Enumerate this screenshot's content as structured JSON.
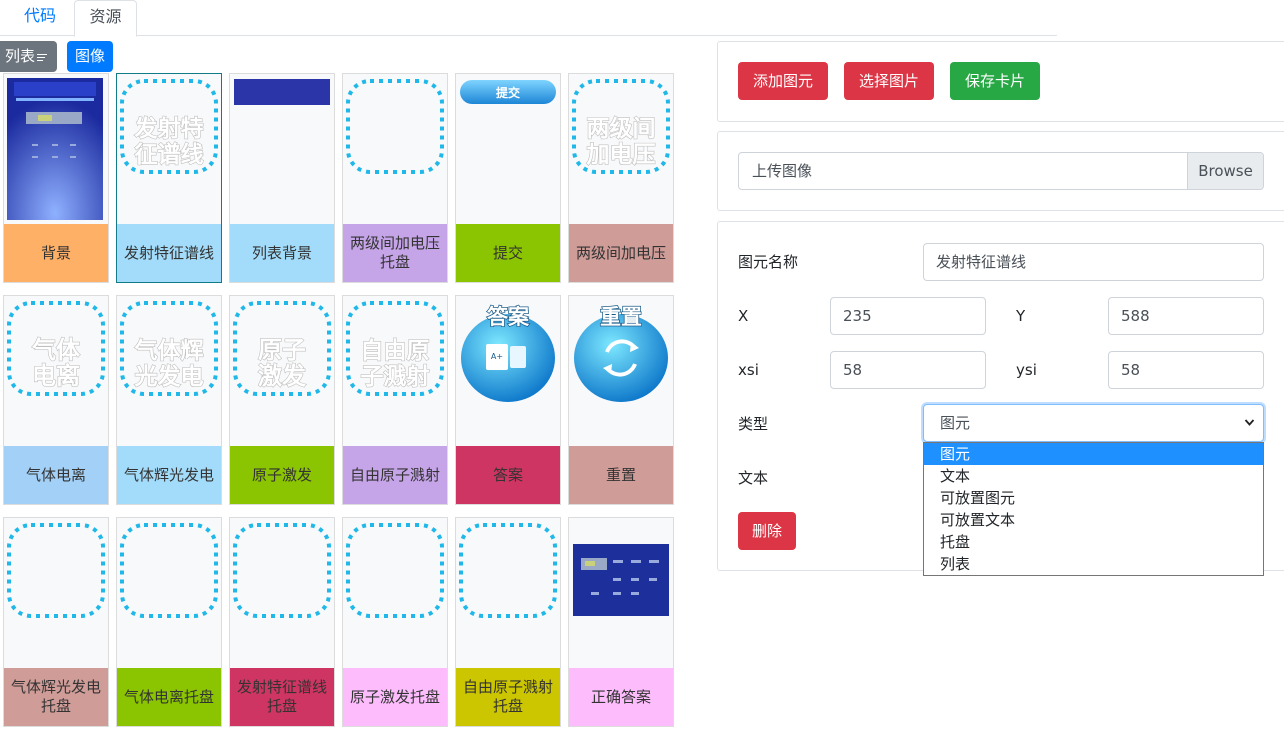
{
  "tabs": {
    "code": "代码",
    "resources": "资源"
  },
  "toolbar": {
    "list_label": "列表",
    "image_label": "图像"
  },
  "cards": [
    {
      "label": "背景",
      "color": "#ffb067",
      "thumb": "background-screenshot"
    },
    {
      "label": "发射特征谱线",
      "color": "#a3dcfa",
      "thumb": "dashed-text",
      "text1": "发射特",
      "text2": "征谱线",
      "selected": true
    },
    {
      "label": "列表背景",
      "color": "#a3dcfa",
      "thumb": "blue-bar"
    },
    {
      "label": "两级间加电压托盘",
      "color": "#c6a4e8",
      "thumb": "dashed-empty"
    },
    {
      "label": "提交",
      "color": "#8bc400",
      "thumb": "submit-button",
      "text1": "提交"
    },
    {
      "label": "两级间加电压",
      "color": "#cf9c98",
      "thumb": "dashed-text",
      "text1": "两级间",
      "text2": "加电压"
    },
    {
      "label": "气体电离",
      "color": "#a3d0f7",
      "thumb": "dashed-text",
      "text1": "气体",
      "text2": "电离"
    },
    {
      "label": "气体辉光发电",
      "color": "#a3dcfa",
      "thumb": "dashed-text",
      "text1": "气体辉",
      "text2": "光发电"
    },
    {
      "label": "原子激发",
      "color": "#8bc400",
      "thumb": "dashed-text",
      "text1": "原子",
      "text2": "激发"
    },
    {
      "label": "自由原子溅射",
      "color": "#c6a4e8",
      "thumb": "dashed-text",
      "text1": "自由原",
      "text2": "子溅射"
    },
    {
      "label": "答案",
      "color": "#cf3562",
      "thumb": "answer-button",
      "text1": "答案"
    },
    {
      "label": "重置",
      "color": "#cf9c98",
      "thumb": "reset-button",
      "text1": "重置"
    },
    {
      "label": "气体辉光发电托盘",
      "color": "#cf9c98",
      "thumb": "dashed-empty"
    },
    {
      "label": "气体电离托盘",
      "color": "#8bc400",
      "thumb": "dashed-empty"
    },
    {
      "label": "发射特征谱线托盘",
      "color": "#cf3562",
      "thumb": "dashed-empty"
    },
    {
      "label": "原子激发托盘",
      "color": "#fdbdfd",
      "thumb": "dashed-empty"
    },
    {
      "label": "自由原子溅射托盘",
      "color": "#ccc600",
      "thumb": "dashed-empty"
    },
    {
      "label": "正确答案",
      "color": "#fdbdfd",
      "thumb": "answer-screenshot"
    }
  ],
  "actions": {
    "add_element": "添加图元",
    "choose_image": "选择图片",
    "save_card": "保存卡片"
  },
  "upload": {
    "label": "上传图像",
    "browse": "Browse"
  },
  "form": {
    "name_label": "图元名称",
    "name_value": "发射特征谱线",
    "x_label": "X",
    "x_value": "235",
    "y_label": "Y",
    "y_value": "588",
    "xsi_label": "xsi",
    "xsi_value": "58",
    "ysi_label": "ysi",
    "ysi_value": "58",
    "type_label": "类型",
    "type_value": "图元",
    "text_label": "文本",
    "delete": "删除"
  },
  "type_options": [
    "图元",
    "文本",
    "可放置图元",
    "可放置文本",
    "托盘",
    "列表"
  ],
  "type_selected_index": 0,
  "colors": {
    "primary": "#007bff",
    "danger": "#dc3545",
    "success": "#28a745",
    "secondary": "#6c757d",
    "dash": "#1fb8e8"
  }
}
